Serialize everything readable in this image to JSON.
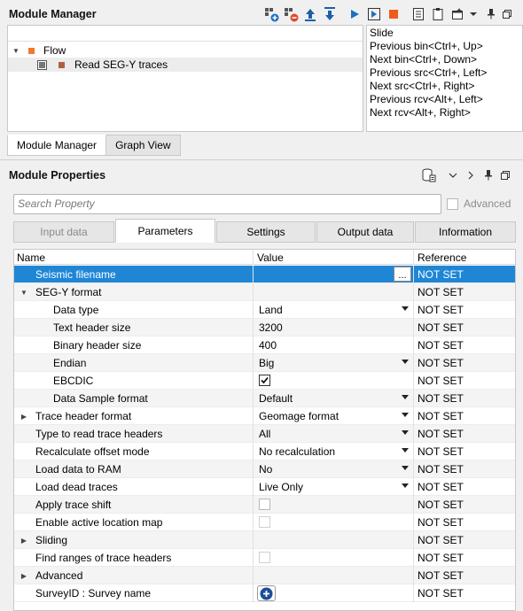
{
  "module_manager": {
    "title": "Module Manager",
    "toolbar_icons": [
      "add-module-icon",
      "remove-module-icon",
      "move-up-icon",
      "move-down-icon",
      "run-icon",
      "run-step-icon",
      "stop-icon",
      "list-icon",
      "clipboard-icon",
      "new-window-icon",
      "chevron-down-icon",
      "pin-icon",
      "restore-icon"
    ],
    "tree": [
      {
        "label": "Flow",
        "level": 0
      },
      {
        "label": "Read SEG-Y traces",
        "level": 1
      }
    ],
    "slide_lines": [
      "Slide",
      "Previous bin<Ctrl+, Up>",
      "Next bin<Ctrl+, Down>",
      "Previous src<Ctrl+, Left>",
      "Next src<Ctrl+, Right>",
      "Previous rcv<Alt+, Left>",
      "Next rcv<Alt+, Right>"
    ],
    "bottom_tabs": [
      "Module Manager",
      "Graph View"
    ]
  },
  "module_properties": {
    "title": "Module Properties",
    "search_placeholder": "Search Property",
    "advanced_label": "Advanced",
    "tabs": [
      "Input data",
      "Parameters",
      "Settings",
      "Output data",
      "Information"
    ],
    "active_tab": "Parameters",
    "columns": [
      "Name",
      "Value",
      "Reference"
    ],
    "rows": [
      {
        "name": "Seismic filename",
        "value": "",
        "ref": "NOT SET",
        "indent": 1,
        "selected": true,
        "button": "..."
      },
      {
        "name": "SEG-Y format",
        "value": "",
        "ref": "NOT SET",
        "indent": 1,
        "expander": "open"
      },
      {
        "name": "Data type",
        "value": "Land",
        "ref": "NOT SET",
        "indent": 2,
        "dropdown": true
      },
      {
        "name": "Text header size",
        "value": "3200",
        "ref": "NOT SET",
        "indent": 2
      },
      {
        "name": "Binary header size",
        "value": "400",
        "ref": "NOT SET",
        "indent": 2
      },
      {
        "name": "Endian",
        "value": "Big",
        "ref": "NOT SET",
        "indent": 2,
        "dropdown": true
      },
      {
        "name": "EBCDIC",
        "value": "",
        "ref": "NOT SET",
        "indent": 2,
        "checkbox": true,
        "checked": true
      },
      {
        "name": "Data Sample format",
        "value": "Default",
        "ref": "NOT SET",
        "indent": 2,
        "dropdown": true
      },
      {
        "name": "Trace header format",
        "value": "Geomage format",
        "ref": "NOT SET",
        "indent": 1,
        "expander": "closed",
        "dropdown": true
      },
      {
        "name": "Type to read trace headers",
        "value": "All",
        "ref": "NOT SET",
        "indent": 1,
        "dropdown": true
      },
      {
        "name": "Recalculate offset mode",
        "value": "No recalculation",
        "ref": "NOT SET",
        "indent": 1,
        "dropdown": true
      },
      {
        "name": "Load data to RAM",
        "value": "No",
        "ref": "NOT SET",
        "indent": 1,
        "dropdown": true
      },
      {
        "name": "Load dead traces",
        "value": "Live Only",
        "ref": "NOT SET",
        "indent": 1,
        "dropdown": true
      },
      {
        "name": "Apply trace shift",
        "value": "",
        "ref": "NOT SET",
        "indent": 1,
        "checkbox": true,
        "checked": false
      },
      {
        "name": "Enable active location map",
        "value": "",
        "ref": "NOT SET",
        "indent": 1,
        "checkbox": true,
        "checked": false,
        "disabled": true
      },
      {
        "name": "Sliding",
        "value": "",
        "ref": "NOT SET",
        "indent": 1,
        "expander": "closed"
      },
      {
        "name": "Find ranges of trace headers",
        "value": "",
        "ref": "NOT SET",
        "indent": 1,
        "checkbox": true,
        "checked": false,
        "disabled": true
      },
      {
        "name": "Advanced",
        "value": "",
        "ref": "NOT SET",
        "indent": 1,
        "expander": "closed"
      },
      {
        "name": "SurveyID : Survey name",
        "value": "",
        "ref": "NOT SET",
        "indent": 1,
        "addbutton": true
      }
    ]
  },
  "colors": {
    "selection": "#1f86d6",
    "accent_blue": "#1e6fc2",
    "stop_orange": "#f05a1e",
    "flow_orange": "#f07a2a",
    "module_brown": "#b06040"
  }
}
